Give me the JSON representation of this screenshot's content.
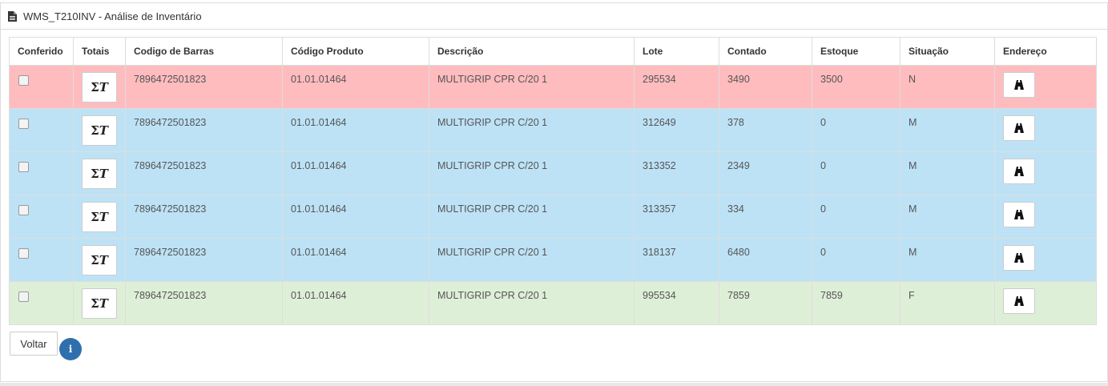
{
  "header": {
    "title": "WMS_T210INV - Análise de Inventário",
    "icon": "document-icon"
  },
  "table": {
    "columns": [
      "Conferido",
      "Totais",
      "Codigo de Barras",
      "Código Produto",
      "Descrição",
      "Lote",
      "Contado",
      "Estoque",
      "Situação",
      "Endereço"
    ],
    "rows": [
      {
        "codigo_barras": "7896472501823",
        "codigo_produto": "01.01.01464",
        "descricao": "MULTIGRIP CPR C/20 1",
        "lote": "295534",
        "contado": "3490",
        "estoque": "3500",
        "situacao": "N"
      },
      {
        "codigo_barras": "7896472501823",
        "codigo_produto": "01.01.01464",
        "descricao": "MULTIGRIP CPR C/20 1",
        "lote": "312649",
        "contado": "378",
        "estoque": "0",
        "situacao": "M"
      },
      {
        "codigo_barras": "7896472501823",
        "codigo_produto": "01.01.01464",
        "descricao": "MULTIGRIP CPR C/20 1",
        "lote": "313352",
        "contado": "2349",
        "estoque": "0",
        "situacao": "M"
      },
      {
        "codigo_barras": "7896472501823",
        "codigo_produto": "01.01.01464",
        "descricao": "MULTIGRIP CPR C/20 1",
        "lote": "313357",
        "contado": "334",
        "estoque": "0",
        "situacao": "M"
      },
      {
        "codigo_barras": "7896472501823",
        "codigo_produto": "01.01.01464",
        "descricao": "MULTIGRIP CPR C/20 1",
        "lote": "318137",
        "contado": "6480",
        "estoque": "0",
        "situacao": "M"
      },
      {
        "codigo_barras": "7896472501823",
        "codigo_produto": "01.01.01464",
        "descricao": "MULTIGRIP CPR C/20 1",
        "lote": "995534",
        "contado": "7859",
        "estoque": "7859",
        "situacao": "F"
      }
    ],
    "totais_button": {
      "sigma": "Σ",
      "t": "T"
    }
  },
  "colors": {
    "situacao_n": "#ffbcbf",
    "situacao_m": "#bde2f6",
    "situacao_f": "#deefd7",
    "info": "#2f6fae"
  },
  "footer": {
    "back_label": "Voltar",
    "info_symbol": "i"
  }
}
